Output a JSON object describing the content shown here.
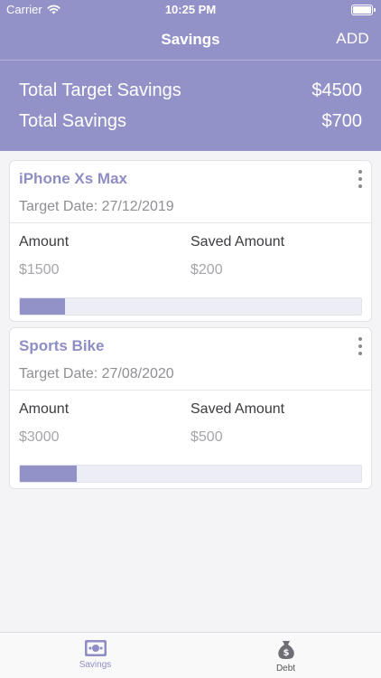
{
  "status_bar": {
    "carrier": "Carrier",
    "time": "10:25 PM"
  },
  "nav": {
    "title": "Savings",
    "add_label": "ADD"
  },
  "summary": {
    "target_label": "Total Target Savings",
    "target_value": "$4500",
    "saved_label": "Total Savings",
    "saved_value": "$700"
  },
  "labels": {
    "amount": "Amount",
    "saved_amount": "Saved Amount"
  },
  "savings": [
    {
      "title": "iPhone Xs Max",
      "target_date": "Target Date: 27/12/2019",
      "amount": "$1500",
      "saved_amount": "$200",
      "progress": 0.133
    },
    {
      "title": "Sports Bike",
      "target_date": "Target Date: 27/08/2020",
      "amount": "$3000",
      "saved_amount": "$500",
      "progress": 0.167
    }
  ],
  "tabs": [
    {
      "label": "Savings",
      "icon": "money-bill-icon",
      "active": true
    },
    {
      "label": "Debt",
      "icon": "money-bag-icon",
      "active": false
    }
  ],
  "colors": {
    "accent": "#9392c8",
    "progress_track": "#ededf5",
    "background": "#f4f4f6"
  }
}
